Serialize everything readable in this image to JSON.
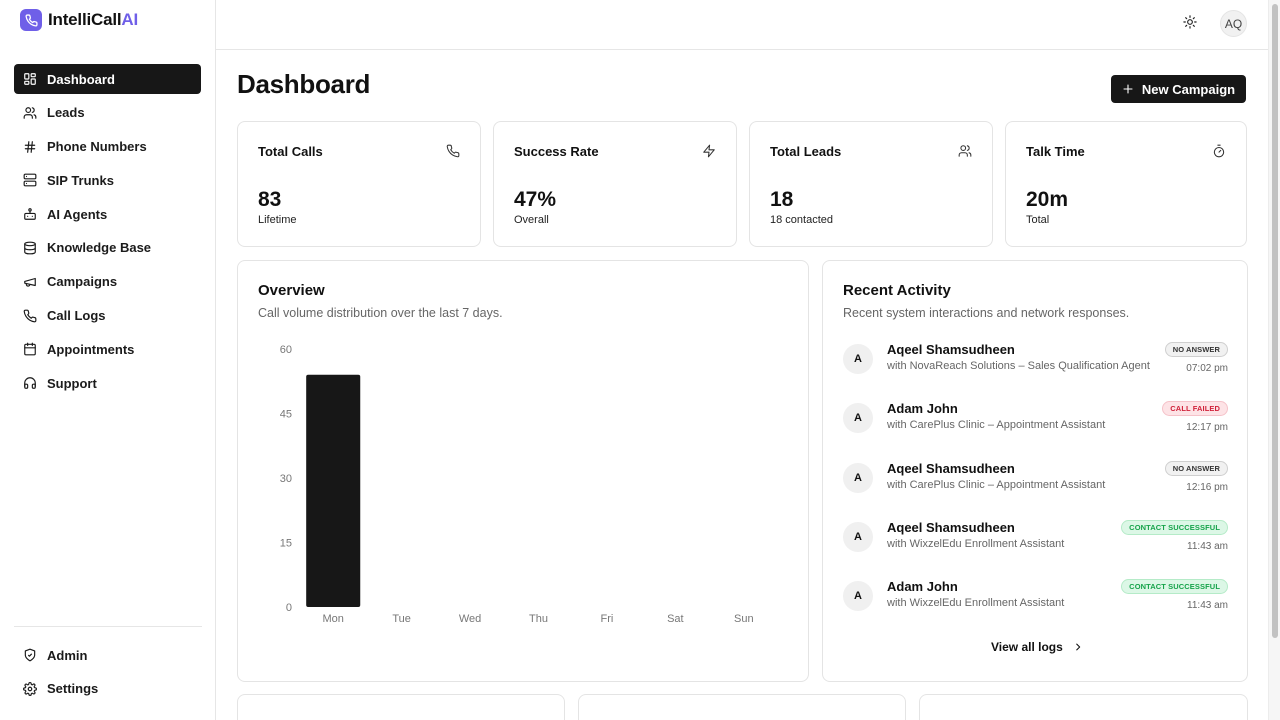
{
  "app": {
    "name_prefix": "IntelliCall",
    "name_suffix": "AI"
  },
  "sidebar": {
    "items": [
      {
        "label": "Dashboard",
        "icon": "dashboard-icon",
        "active": true
      },
      {
        "label": "Leads",
        "icon": "users-icon"
      },
      {
        "label": "Phone Numbers",
        "icon": "hash-icon"
      },
      {
        "label": "SIP Trunks",
        "icon": "server-icon"
      },
      {
        "label": "AI Agents",
        "icon": "bot-icon"
      },
      {
        "label": "Knowledge Base",
        "icon": "database-icon"
      },
      {
        "label": "Campaigns",
        "icon": "megaphone-icon"
      },
      {
        "label": "Call Logs",
        "icon": "phone-icon"
      },
      {
        "label": "Appointments",
        "icon": "calendar-icon"
      },
      {
        "label": "Support",
        "icon": "headset-icon"
      }
    ],
    "bottom_items": [
      {
        "label": "Admin",
        "icon": "shield-icon"
      },
      {
        "label": "Settings",
        "icon": "gear-icon"
      }
    ]
  },
  "header": {
    "avatar_initials": "AQ",
    "theme_icon": "sun-icon"
  },
  "page": {
    "title": "Dashboard",
    "new_campaign_label": "New Campaign"
  },
  "stats": [
    {
      "label": "Total Calls",
      "value": "83",
      "sub": "Lifetime",
      "icon": "phone-icon"
    },
    {
      "label": "Success Rate",
      "value": "47%",
      "sub": "Overall",
      "icon": "zap-icon"
    },
    {
      "label": "Total Leads",
      "value": "18",
      "sub": "18 contacted",
      "icon": "users-icon"
    },
    {
      "label": "Talk Time",
      "value": "20m",
      "sub": "Total",
      "icon": "timer-icon"
    }
  ],
  "overview": {
    "title": "Overview",
    "description": "Call volume distribution over the last 7 days."
  },
  "chart_data": {
    "type": "bar",
    "categories": [
      "Mon",
      "Tue",
      "Wed",
      "Thu",
      "Fri",
      "Sat",
      "Sun"
    ],
    "values": [
      54,
      0,
      0,
      0,
      0,
      0,
      0
    ],
    "ylim": [
      0,
      60
    ],
    "yticks": [
      0,
      15,
      30,
      45,
      60
    ],
    "bar_color": "#171717",
    "grid": false,
    "title": "",
    "xlabel": "",
    "ylabel": ""
  },
  "activity": {
    "title": "Recent Activity",
    "description": "Recent system interactions and network responses.",
    "items": [
      {
        "initial": "A",
        "name": "Aqeel Shamsudheen",
        "detail": "with NovaReach Solutions – Sales Qualification Agent",
        "status": "NO ANSWER",
        "status_kind": "gray",
        "time": "07:02 pm"
      },
      {
        "initial": "A",
        "name": "Adam John",
        "detail": "with CarePlus Clinic – Appointment Assistant",
        "status": "CALL FAILED",
        "status_kind": "red",
        "time": "12:17 pm"
      },
      {
        "initial": "A",
        "name": "Aqeel Shamsudheen",
        "detail": "with CarePlus Clinic – Appointment Assistant",
        "status": "NO ANSWER",
        "status_kind": "gray",
        "time": "12:16 pm"
      },
      {
        "initial": "A",
        "name": "Aqeel Shamsudheen",
        "detail": "with WixzelEdu Enrollment Assistant",
        "status": "CONTACT SUCCESSFUL",
        "status_kind": "green",
        "time": "11:43 am"
      },
      {
        "initial": "A",
        "name": "Adam John",
        "detail": "with WixzelEdu Enrollment Assistant",
        "status": "CONTACT SUCCESSFUL",
        "status_kind": "green",
        "time": "11:43 am"
      }
    ],
    "view_all_label": "View all logs"
  },
  "colors": {
    "accent": "#6f5fe8",
    "primary": "#171717"
  }
}
